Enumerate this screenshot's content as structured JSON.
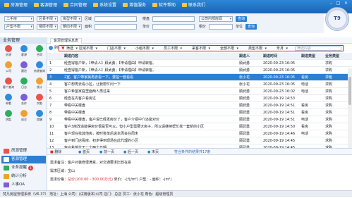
{
  "menu": {
    "items": [
      {
        "label": "房源管理"
      },
      {
        "label": "客源管理"
      },
      {
        "label": "合同管理"
      },
      {
        "label": "系统设置"
      },
      {
        "label": "增值服务"
      },
      {
        "label": "软件帮助"
      },
      {
        "label": "联系我们"
      }
    ],
    "logo_text": "T9"
  },
  "filters": {
    "row1": [
      {
        "value": "二手房"
      },
      {
        "value": "区县不限"
      },
      {
        "value": "房型不限"
      },
      {
        "value": "区域"
      },
      {
        "value": "楼盘"
      },
      {
        "value": "公司内部房源"
      }
    ],
    "row2": [
      {
        "value": "户型不限"
      },
      {
        "value": "楼层不限"
      },
      {
        "value": "朝向不限"
      },
      {
        "value": "面积"
      },
      {
        "value": "单价"
      },
      {
        "value": "租价"
      },
      {
        "value": "单位"
      }
    ],
    "query_label": "查询",
    "query2_label": "查询"
  },
  "sidebar": {
    "title": "业务管理",
    "grid": [
      {
        "label": "房源",
        "color": "#e9544b"
      },
      {
        "label": "客源",
        "color": "#2f8be0"
      },
      {
        "label": "合同",
        "color": "#2cae5f"
      },
      {
        "label": "公司",
        "color": "#f0a030"
      },
      {
        "label": "跟进",
        "color": "#7a5fd6"
      },
      {
        "label": "房源查询",
        "color": "#2f8be0"
      },
      {
        "label": "客户查询",
        "color": "#e9544b"
      },
      {
        "label": "日志",
        "color": "#2cae5f"
      },
      {
        "label": "统计",
        "color": "#f0a030"
      },
      {
        "label": "带看",
        "color": "#2f8be0"
      },
      {
        "label": "合作",
        "color": "#7a5fd6"
      },
      {
        "label": "实勘",
        "color": "#e9544b"
      },
      {
        "label": "钥匙",
        "color": "#2cae5f"
      },
      {
        "label": "成交",
        "color": "#f0a030"
      },
      {
        "label": "提醒",
        "color": "#2f8be0"
      }
    ],
    "rows": [
      {
        "label": "房源管理",
        "color": "#e9544b"
      },
      {
        "label": "客源管理",
        "color": "#2f8be0"
      },
      {
        "label": "业务提醒",
        "color": "#2cae5f",
        "badge": "1"
      },
      {
        "label": "统计分析",
        "color": "#f0a030"
      },
      {
        "label": "人事OA",
        "color": "#7a5fd6"
      }
    ]
  },
  "tab": {
    "label": "客源管理信息表"
  },
  "toolbar": {
    "refresh": "刷新",
    "filter_label": "筛选",
    "chips": [
      "区域不限",
      "门店不限",
      "小组不限",
      "员工不限",
      "来客不限",
      "全部不限",
      "类型不限",
      "年月"
    ],
    "search_placeholder": "筛选内容"
  },
  "grid": {
    "headers": [
      "",
      "跟进内容",
      "跟进人",
      "跟进时间",
      "跟进类型",
      "业务类型"
    ],
    "rows": [
      {
        "n": "1",
        "text": "经查得客户新，【申请人】顾武勇；【申请理由】申请转客。",
        "who": "顾武勇",
        "time": "2020-09-23 16:05",
        "type": "",
        "biz": "求购"
      },
      {
        "n": "2",
        "text": "经查得客户新，【申请人】顾武勇；【申请理由】申请转客。",
        "who": "顾武勇",
        "time": "2020-09-23 16:05",
        "type": "",
        "biz": "求购"
      },
      {
        "n": "3",
        "text": "2室，客户带家属再去看一下，要拍一套看看",
        "who": "张小花",
        "time": "2020-09-23 16:05",
        "type": "看房",
        "biz": "求租"
      },
      {
        "n": "4",
        "text": "客户想再去看小区，让我帮忙问一下",
        "who": "张小花",
        "time": "2020-09-23 16:05",
        "type": "电话",
        "biz": "求购"
      },
      {
        "n": "5",
        "text": "客户希望家庭里面两人再过来",
        "who": "顾武勇",
        "time": "2020-09-23 16:02",
        "type": "电话",
        "biz": "求购"
      },
      {
        "n": "6",
        "text": "经查在内客户看房过",
        "who": "顾武勇",
        "time": "2020-09-19 14:53",
        "type": "",
        "biz": "求购"
      },
      {
        "n": "7",
        "text": "带看中关楼盘",
        "who": "顾武勇",
        "time": "2020-09-19 14:51",
        "type": "看房",
        "biz": "求购"
      },
      {
        "n": "8",
        "text": "带看中关楼盘",
        "who": "顾武勇",
        "time": "2020-09-19 14:51",
        "type": "看房",
        "biz": "求购"
      },
      {
        "n": "9",
        "text": "带看中关楼盘，客户说已经发房价了，客户介绍中介还能对价",
        "who": "顾武勇",
        "time": "2020-09-19 14:51",
        "type": "电话",
        "biz": "求购"
      },
      {
        "n": "10",
        "text": "客户3房改造能得房价很是否可以，但小户型需要大房子，所以请继续帮忙找一套新的小区",
        "who": "顾武勇",
        "time": "2020-09-19 14:50",
        "type": "看房",
        "biz": "求购"
      },
      {
        "n": "11",
        "text": "客户现在找其他房，按时签单后说本周会在周末",
        "who": "顾武勇",
        "time": "2020-09-19 14:46",
        "type": "电话",
        "biz": "求购"
      },
      {
        "n": "12",
        "text": "客户到门店看房，初步得到现场在此代理的小区",
        "who": "顾武勇",
        "time": "2020-09-19 14:45",
        "type": "",
        "biz": "求购"
      },
      {
        "n": "13",
        "text": "客户希望位于一个两个日期",
        "who": "顾武勇",
        "time": "2020-09-19 14:45",
        "type": "",
        "biz": "求购"
      }
    ]
  },
  "bottombar": {
    "delete": "删除",
    "first": "首页",
    "prev": "前一页",
    "next": "后一页",
    "last": "末页",
    "summary": "符合条件的结果共17条"
  },
  "detail": {
    "line1": "需求备注：客户对装修很满意，对交通要求比较在意",
    "line2": "需求区域：宝山",
    "line3_prefix": "需求价格：",
    "line3_price": "总价(200.00 - 300.00万元)",
    "line3_suffix": "  单价：-(元/m²) 户型：-  面积：-(m²)"
  },
  "status": {
    "text": "梵凡房屋管理系统（V6.37） 地址：上海 公司：(试用版本)公司 店门：总店 员工：张小花 角色：超级管理员"
  }
}
